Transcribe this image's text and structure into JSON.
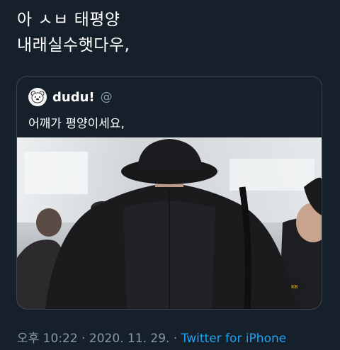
{
  "tweet": {
    "lines": [
      "아 ㅅㅂ 태평양",
      "내래실수햇다우,"
    ]
  },
  "quoted": {
    "author_name": "dudu!",
    "author_handle": "@",
    "text": "어깨가 평양이세요,",
    "image_badge": "KB"
  },
  "meta": {
    "time": "오후 10:22",
    "separator": " · ",
    "date": "2020. 11. 29.",
    "separator2": " · ",
    "source": "Twitter for iPhone"
  },
  "colors": {
    "background": "#15202b",
    "card_border": "#38444d",
    "muted_text": "#8899a6",
    "link": "#1da1f2"
  }
}
